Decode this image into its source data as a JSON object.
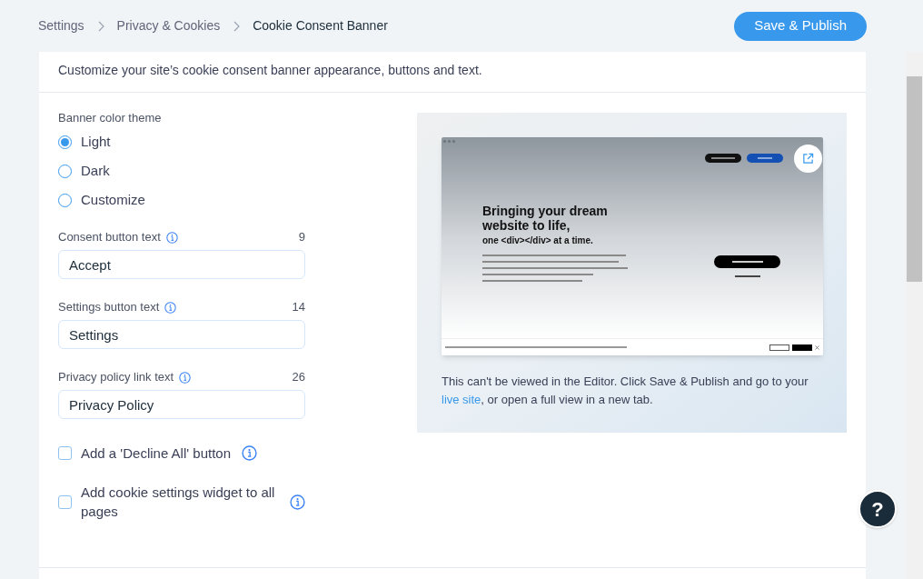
{
  "breadcrumbs": [
    {
      "label": "Settings",
      "selected": false
    },
    {
      "label": "Privacy & Cookies",
      "selected": false
    },
    {
      "label": "Cookie Consent Banner",
      "selected": true
    }
  ],
  "publish_button": "Save & Publish",
  "section": {
    "description": "Customize your site’s cookie consent banner appearance, buttons and text."
  },
  "theme": {
    "label": "Banner color theme",
    "options": [
      {
        "label": "Light",
        "selected": true
      },
      {
        "label": "Dark",
        "selected": false
      },
      {
        "label": "Customize",
        "selected": false
      }
    ]
  },
  "text_fields": [
    {
      "label": "Consent button text",
      "count": "9",
      "value": "Accept"
    },
    {
      "label": "Settings button text",
      "count": "14",
      "value": "Settings"
    },
    {
      "label": "Privacy policy link text",
      "count": "26",
      "value": "Privacy Policy"
    }
  ],
  "checkboxes": [
    {
      "label": "Add a 'Decline All' button",
      "checked": false
    },
    {
      "label": "Add cookie settings widget to all pages",
      "checked": false
    }
  ],
  "preview": {
    "site": {
      "headline": "Bringing your dream website to life,",
      "tagline": "one <div></div> at a time."
    },
    "note": "This can't be viewed in the Editor. Click Save & Publish and go to your",
    "link": "live site",
    "note_end": ", or open a full view in a new tab."
  },
  "help_button": "?"
}
